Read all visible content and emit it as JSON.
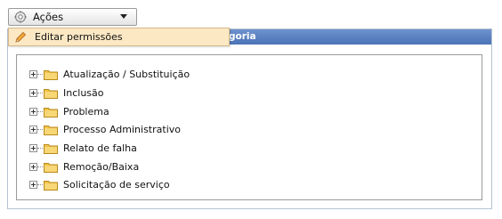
{
  "actions": {
    "label": "Ações"
  },
  "menu": {
    "items": [
      {
        "label": "Editar permissões"
      }
    ]
  },
  "panel": {
    "title_visible": "goria"
  },
  "tree": {
    "items": [
      {
        "label": "Atualização / Substituição"
      },
      {
        "label": "Inclusão"
      },
      {
        "label": "Problema"
      },
      {
        "label": "Processo Administrativo"
      },
      {
        "label": "Relato de falha"
      },
      {
        "label": "Remoção/Baixa"
      },
      {
        "label": "Solicitação de serviço"
      }
    ]
  },
  "colors": {
    "header": "#4b72b6",
    "menu_bg": "#fde8c4",
    "folder": "#f2c24a"
  }
}
